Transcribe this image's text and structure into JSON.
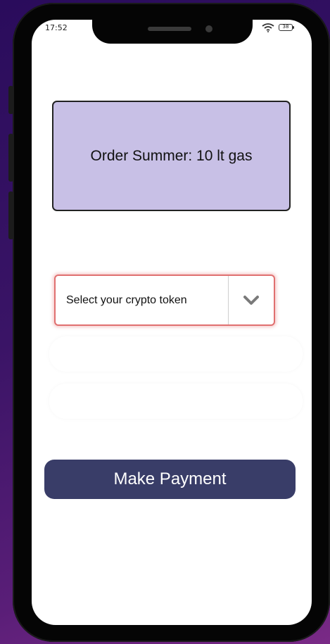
{
  "status_bar": {
    "time": "17:52",
    "wifi_icon": "wifi-icon",
    "battery_label": "38"
  },
  "order": {
    "summary": "Order Summer: 10 lt gas"
  },
  "token_select": {
    "label": "Select your crypto token",
    "toggle_icon": "chevron-down-icon",
    "border_color": "#e07070"
  },
  "payment": {
    "button_label": "Make Payment",
    "button_color": "#393d68"
  },
  "colors": {
    "summary_bg": "#c8c0e6",
    "background_start": "#2a0c5c",
    "background_end": "#7a2a86"
  }
}
